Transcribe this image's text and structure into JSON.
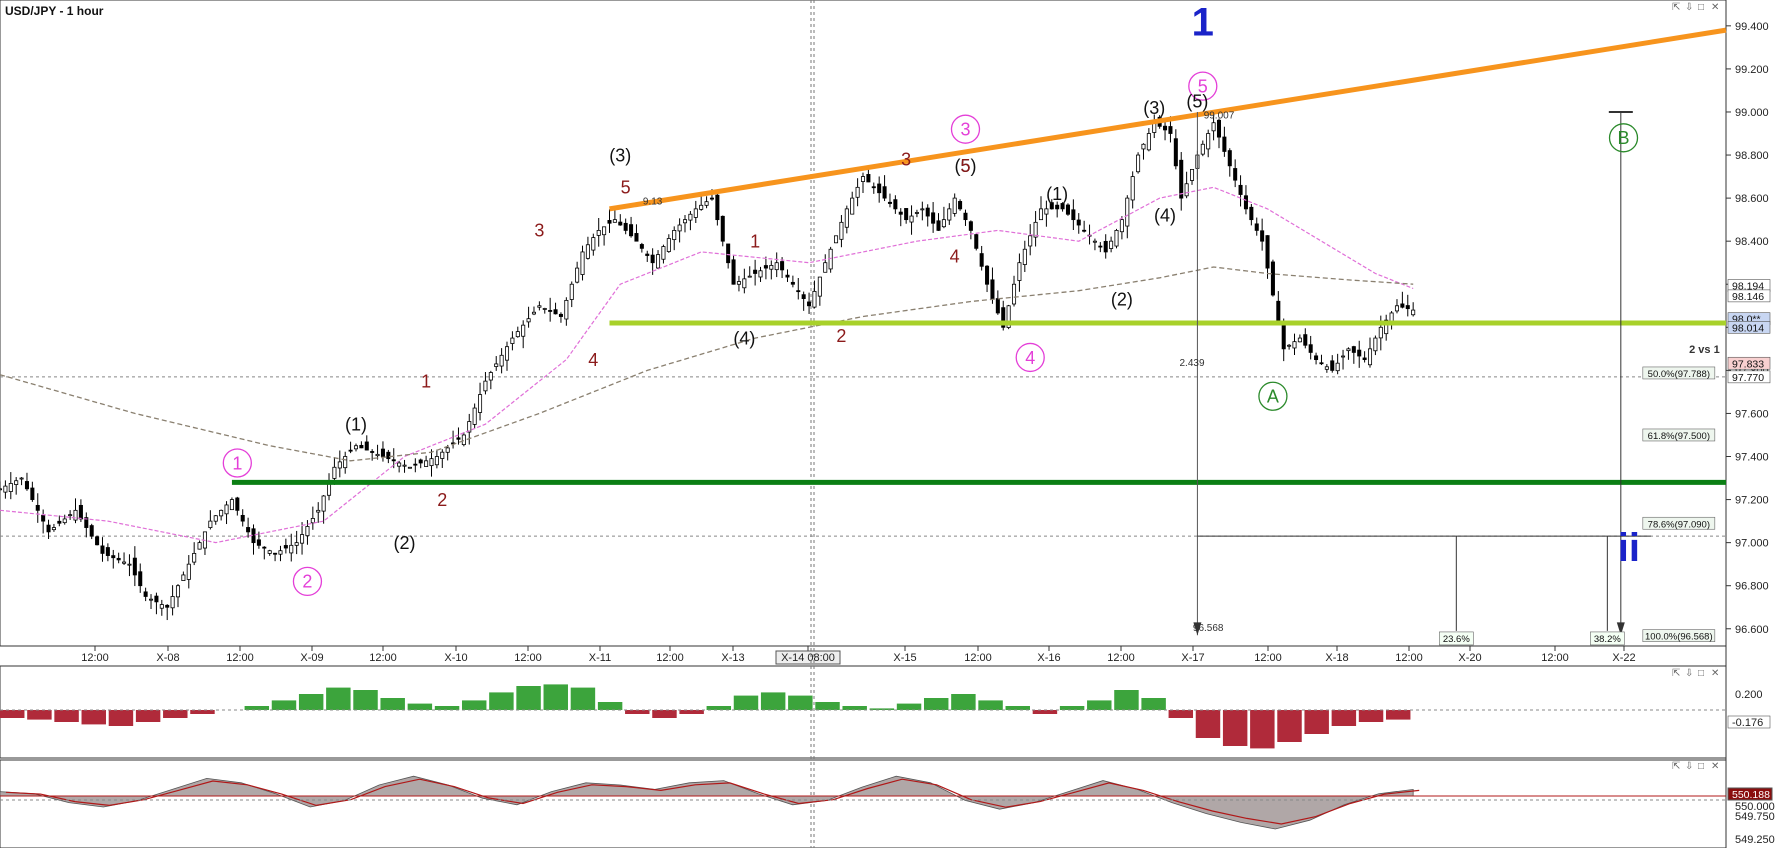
{
  "window": {
    "title": "USD/JPY - 1 hour",
    "pane_buttons": [
      "⇱",
      "⇩",
      "□",
      "✕"
    ]
  },
  "colors": {
    "background": "#ffffff",
    "grid": "#b8b8b8",
    "bull_candle": "#ffffff",
    "bear_candle": "#000000",
    "orange_trendline": "#f7941d",
    "lime_line": "#a8d12a",
    "green_line": "#0b7f14",
    "wave_magenta": "#e43fd8",
    "wave_darkred": "#8b1a1a",
    "wave_blue": "#1a23c9",
    "wave_green": "#2b8a2b",
    "hist_red": "#b02a3a",
    "hist_green": "#3ca43c",
    "fast_ma": "#e070d8",
    "slow_ma": "#8a8070"
  },
  "chart_data": {
    "type": "candlestick",
    "symbol": "USD/JPY",
    "timeframe": "1 hour",
    "ylim": [
      96.52,
      99.52
    ],
    "y_ticks": [
      96.6,
      96.8,
      97.0,
      97.2,
      97.4,
      97.6,
      97.8,
      98.0,
      98.2,
      98.4,
      98.6,
      98.8,
      99.0,
      99.2,
      99.4
    ],
    "y_tick_labels": [
      "96.600",
      "96.800",
      "97.000",
      "97.200",
      "97.400",
      "97.600",
      "97.800",
      "98.000",
      "98.200",
      "98.400",
      "98.600",
      "98.800",
      "99.000",
      "99.200",
      "99.400"
    ],
    "x_labels": [
      "12:00",
      "X-08",
      "12:00",
      "X-09",
      "12:00",
      "X-10",
      "12:00",
      "X-11",
      "12:00",
      "X-13",
      "X-14 08:00",
      "X-15",
      "12:00",
      "X-16",
      "12:00",
      "X-17",
      "12:00",
      "X-18",
      "12:00",
      "X-20",
      "12:00",
      "X-22"
    ],
    "price_path": [
      [
        0,
        97.25
      ],
      [
        4,
        97.3
      ],
      [
        9,
        97.05
      ],
      [
        14,
        97.15
      ],
      [
        19,
        96.95
      ],
      [
        24,
        96.9
      ],
      [
        27,
        96.75
      ],
      [
        31,
        96.7
      ],
      [
        35,
        96.9
      ],
      [
        39,
        97.1
      ],
      [
        43,
        97.2
      ],
      [
        47,
        97.0
      ],
      [
        51,
        96.95
      ],
      [
        55,
        97.0
      ],
      [
        59,
        97.15
      ],
      [
        62,
        97.35
      ],
      [
        66,
        97.45
      ],
      [
        71,
        97.4
      ],
      [
        76,
        97.35
      ],
      [
        81,
        97.4
      ],
      [
        86,
        97.5
      ],
      [
        90,
        97.75
      ],
      [
        95,
        97.95
      ],
      [
        100,
        98.1
      ],
      [
        104,
        98.05
      ],
      [
        108,
        98.35
      ],
      [
        111,
        98.45
      ],
      [
        114,
        98.5
      ],
      [
        118,
        98.4
      ],
      [
        121,
        98.3
      ],
      [
        125,
        98.45
      ],
      [
        129,
        98.55
      ],
      [
        132,
        98.6
      ],
      [
        136,
        98.2
      ],
      [
        140,
        98.25
      ],
      [
        144,
        98.3
      ],
      [
        147,
        98.2
      ],
      [
        150,
        98.1
      ],
      [
        153,
        98.3
      ],
      [
        157,
        98.55
      ],
      [
        160,
        98.7
      ],
      [
        164,
        98.6
      ],
      [
        168,
        98.5
      ],
      [
        171,
        98.55
      ],
      [
        174,
        98.45
      ],
      [
        177,
        98.6
      ],
      [
        180,
        98.45
      ],
      [
        183,
        98.2
      ],
      [
        186,
        98.0
      ],
      [
        189,
        98.3
      ],
      [
        193,
        98.55
      ],
      [
        197,
        98.55
      ],
      [
        201,
        98.45
      ],
      [
        205,
        98.35
      ],
      [
        208,
        98.5
      ],
      [
        211,
        98.8
      ],
      [
        214,
        98.95
      ],
      [
        217,
        98.9
      ],
      [
        219,
        98.6
      ],
      [
        222,
        98.8
      ],
      [
        225,
        98.95
      ],
      [
        228,
        98.75
      ],
      [
        231,
        98.55
      ],
      [
        234,
        98.4
      ],
      [
        236,
        98.15
      ],
      [
        238,
        97.9
      ],
      [
        241,
        97.95
      ],
      [
        244,
        97.85
      ],
      [
        247,
        97.8
      ],
      [
        250,
        97.9
      ],
      [
        253,
        97.85
      ],
      [
        256,
        98.0
      ],
      [
        259,
        98.1
      ],
      [
        262,
        98.08
      ]
    ],
    "fast_ma": [
      [
        0,
        97.15
      ],
      [
        20,
        97.1
      ],
      [
        40,
        97.0
      ],
      [
        60,
        97.1
      ],
      [
        75,
        97.4
      ],
      [
        90,
        97.55
      ],
      [
        105,
        97.85
      ],
      [
        115,
        98.2
      ],
      [
        130,
        98.35
      ],
      [
        150,
        98.3
      ],
      [
        170,
        98.4
      ],
      [
        185,
        98.45
      ],
      [
        200,
        98.4
      ],
      [
        215,
        98.6
      ],
      [
        225,
        98.65
      ],
      [
        235,
        98.55
      ],
      [
        245,
        98.4
      ],
      [
        255,
        98.25
      ],
      [
        262,
        98.18
      ]
    ],
    "slow_ma": [
      [
        0,
        97.78
      ],
      [
        25,
        97.6
      ],
      [
        50,
        97.45
      ],
      [
        65,
        97.38
      ],
      [
        80,
        97.42
      ],
      [
        100,
        97.6
      ],
      [
        120,
        97.8
      ],
      [
        140,
        97.95
      ],
      [
        160,
        98.05
      ],
      [
        180,
        98.12
      ],
      [
        200,
        98.17
      ],
      [
        215,
        98.23
      ],
      [
        225,
        98.28
      ],
      [
        235,
        98.25
      ],
      [
        250,
        98.22
      ],
      [
        262,
        98.2
      ]
    ],
    "trendlines": [
      {
        "name": "orange-upper-channel",
        "from": [
          113,
          98.55
        ],
        "to": [
          320,
          99.38
        ]
      },
      {
        "name": "lime-support",
        "level": 98.02,
        "from_x": 113,
        "to_x": 320
      },
      {
        "name": "green-support",
        "level": 97.28,
        "from_x": 43,
        "to_x": 320
      }
    ],
    "reference_lines": [
      {
        "name": "dashed-97770",
        "level": 97.77
      },
      {
        "name": "dashed-97000",
        "level": 97.03
      }
    ],
    "wave_labels": [
      {
        "text": "1",
        "x": 223,
        "price": 99.42,
        "color": "blue",
        "size": "large"
      },
      {
        "text": "5",
        "x": 223,
        "price": 99.12,
        "color": "magenta",
        "circled": true
      },
      {
        "text": "3",
        "x": 179,
        "price": 98.92,
        "color": "magenta",
        "circled": true
      },
      {
        "text": "4",
        "x": 191,
        "price": 97.86,
        "color": "magenta",
        "circled": true
      },
      {
        "text": "1",
        "x": 44,
        "price": 97.37,
        "color": "magenta",
        "circled": true
      },
      {
        "text": "2",
        "x": 57,
        "price": 96.82,
        "color": "magenta",
        "circled": true
      },
      {
        "text": "(1)",
        "x": 66,
        "price": 97.55,
        "color": "black"
      },
      {
        "text": "(2)",
        "x": 75,
        "price": 97.0,
        "color": "black"
      },
      {
        "text": "(3)",
        "x": 115,
        "price": 98.8,
        "color": "black"
      },
      {
        "text": "(4)",
        "x": 138,
        "price": 97.95,
        "color": "black"
      },
      {
        "text": "(5)",
        "x": 179,
        "price": 98.75,
        "color": "black"
      },
      {
        "text": "(1)",
        "x": 196,
        "price": 98.62,
        "color": "black"
      },
      {
        "text": "(2)",
        "x": 208,
        "price": 98.13,
        "color": "black"
      },
      {
        "text": "(3)",
        "x": 214,
        "price": 99.02,
        "color": "black"
      },
      {
        "text": "(4)",
        "x": 216,
        "price": 98.52,
        "color": "black"
      },
      {
        "text": "(5)",
        "x": 222,
        "price": 99.05,
        "color": "black"
      },
      {
        "text": "5",
        "x": 116,
        "price": 98.65,
        "color": "darkred"
      },
      {
        "text": "3",
        "x": 100,
        "price": 98.45,
        "color": "darkred"
      },
      {
        "text": "4",
        "x": 110,
        "price": 97.85,
        "color": "darkred"
      },
      {
        "text": "1",
        "x": 79,
        "price": 97.75,
        "color": "darkred"
      },
      {
        "text": "2",
        "x": 82,
        "price": 97.2,
        "color": "darkred"
      },
      {
        "text": "1",
        "x": 140,
        "price": 98.4,
        "color": "darkred"
      },
      {
        "text": "2",
        "x": 156,
        "price": 97.96,
        "color": "darkred"
      },
      {
        "text": "3",
        "x": 168,
        "price": 98.78,
        "color": "darkred"
      },
      {
        "text": "5",
        "x": 179,
        "price": 98.75,
        "color": "darkred"
      },
      {
        "text": "4",
        "x": 177,
        "price": 98.33,
        "color": "darkred"
      },
      {
        "text": "A",
        "x": 236,
        "price": 97.68,
        "color": "green",
        "circled": true
      },
      {
        "text": "B",
        "x": 301,
        "price": 98.88,
        "color": "green",
        "circled": true
      },
      {
        "text": "ii",
        "x": 302,
        "price": 96.98,
        "color": "blue",
        "size": "large"
      }
    ],
    "annotations": [
      {
        "text": "9.13",
        "x": 121,
        "price": 98.57
      },
      {
        "text": "99.007",
        "x": 226,
        "price": 98.97
      },
      {
        "text": "2.439",
        "x": 221,
        "price": 97.82
      },
      {
        "text": "96.568",
        "x": 224,
        "price": 96.59
      },
      {
        "text": "2 vs 1",
        "x": 316,
        "price": 97.88
      }
    ],
    "fibonacci": [
      {
        "label": "50.0%(97.788)",
        "price": 97.788
      },
      {
        "label": "61.8%(97.500)",
        "price": 97.5
      },
      {
        "label": "78.6%(97.090)",
        "price": 97.09
      },
      {
        "label": "100.0%(96.568)",
        "price": 96.568
      }
    ],
    "fib_badges": [
      {
        "label": "23.6%",
        "x": 270,
        "price": 96.59
      },
      {
        "label": "38.2%",
        "x": 298,
        "price": 96.59
      }
    ],
    "price_badges": [
      {
        "label": "98.194",
        "price": 98.194,
        "style": "plain"
      },
      {
        "label": "98.146",
        "price": 98.146,
        "style": "plain"
      },
      {
        "label": "98.0**",
        "price": 98.04,
        "style": "blue"
      },
      {
        "label": "98.014",
        "price": 98.0,
        "style": "blue"
      },
      {
        "label": "97.833",
        "price": 97.833,
        "style": "red"
      },
      {
        "label": "97.770",
        "price": 97.77,
        "style": "plain"
      }
    ],
    "oscillator1": {
      "ticks": [
        "0.200",
        "-0.176"
      ],
      "histogram": [
        -0.1,
        -0.12,
        -0.15,
        -0.18,
        -0.2,
        -0.15,
        -0.1,
        -0.05,
        0,
        0.05,
        0.12,
        0.2,
        0.28,
        0.25,
        0.15,
        0.08,
        0.05,
        0.12,
        0.22,
        0.3,
        0.32,
        0.28,
        0.1,
        -0.05,
        -0.1,
        -0.05,
        0.05,
        0.18,
        0.22,
        0.18,
        0.1,
        0.05,
        0.02,
        0.08,
        0.15,
        0.2,
        0.12,
        0.05,
        -0.05,
        0.05,
        0.12,
        0.25,
        0.15,
        -0.1,
        -0.35,
        -0.45,
        -0.48,
        -0.4,
        -0.3,
        -0.2,
        -0.15,
        -0.12
      ]
    },
    "oscillator2": {
      "ticks": [
        "550.188",
        "550.000",
        "549.750",
        "549.250"
      ],
      "wave": [
        0.2,
        0.1,
        -0.3,
        -0.5,
        -0.2,
        0.3,
        0.8,
        0.6,
        0.1,
        -0.5,
        -0.2,
        0.5,
        0.9,
        0.5,
        -0.1,
        -0.4,
        0.2,
        0.6,
        0.5,
        0.3,
        0.6,
        0.7,
        0.1,
        -0.4,
        -0.2,
        0.4,
        0.9,
        0.6,
        -0.2,
        -0.6,
        -0.3,
        0.2,
        0.7,
        0.3,
        -0.3,
        -0.8,
        -1.2,
        -1.5,
        -1.1,
        -0.4,
        0.1,
        0.3
      ]
    }
  }
}
